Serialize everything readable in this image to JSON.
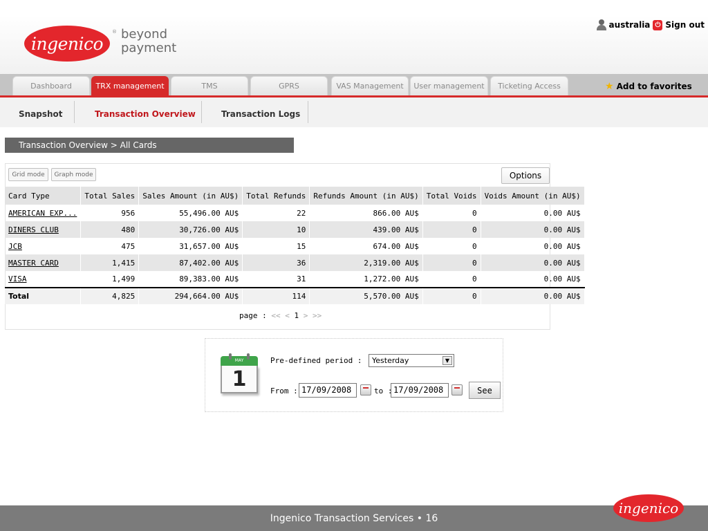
{
  "header": {
    "logo_text": "ingenico",
    "logo_mark": "®",
    "tagline_line1": "beyond",
    "tagline_line2": "payment",
    "user_name": "australia",
    "signout_label": "Sign out"
  },
  "menu": {
    "tabs": [
      {
        "label": "Dashboard"
      },
      {
        "label": "TRX management"
      },
      {
        "label": "TMS"
      },
      {
        "label": "GPRS"
      },
      {
        "label": "VAS Management"
      },
      {
        "label": "User management"
      },
      {
        "label": "Ticketing Access"
      }
    ],
    "active_tab": "TRX management",
    "favorites_label": "Add to favorites"
  },
  "subnav": {
    "items": [
      {
        "label": "Snapshot"
      },
      {
        "label": "Transaction Overview"
      },
      {
        "label": "Transaction Logs"
      }
    ],
    "active": "Transaction Overview"
  },
  "breadcrumb": "Transaction Overview > All Cards",
  "toolbar": {
    "grid_mode": "Grid mode",
    "graph_mode": "Graph mode",
    "options": "Options"
  },
  "table": {
    "columns": [
      "Card Type",
      "Total Sales",
      "Sales Amount (in AU$)",
      "Total Refunds",
      "Refunds Amount (in AU$)",
      "Total Voids",
      "Voids Amount (in AU$)"
    ],
    "rows": [
      [
        "AMERICAN EXP...",
        "956",
        "55,496.00 AU$",
        "22",
        "866.00 AU$",
        "0",
        "0.00 AU$"
      ],
      [
        "DINERS CLUB",
        "480",
        "30,726.00 AU$",
        "10",
        "439.00 AU$",
        "0",
        "0.00 AU$"
      ],
      [
        "JCB",
        "475",
        "31,657.00 AU$",
        "15",
        "674.00 AU$",
        "0",
        "0.00 AU$"
      ],
      [
        "MASTER CARD",
        "1,415",
        "87,402.00 AU$",
        "36",
        "2,319.00 AU$",
        "0",
        "0.00 AU$"
      ],
      [
        "VISA",
        "1,499",
        "89,383.00 AU$",
        "31",
        "1,272.00 AU$",
        "0",
        "0.00 AU$"
      ]
    ],
    "total": [
      "Total",
      "4,825",
      "294,664.00 AU$",
      "114",
      "5,570.00 AU$",
      "0",
      "0.00 AU$"
    ]
  },
  "pager": {
    "label": "page :",
    "first": "<<",
    "prev": "<",
    "current": "1",
    "next": ">",
    "last": ">>"
  },
  "period": {
    "calendar_month": "MAY",
    "calendar_day": "1",
    "predefined_label": "Pre-defined period :",
    "predefined_value": "Yesterday",
    "from_label": "From :",
    "from_value": "17/09/2008",
    "to_label": "to :",
    "to_value": "17/09/2008",
    "see_label": "See"
  },
  "footer": {
    "text": "Ingenico Transaction Services • 16",
    "logo_text": "ingenico"
  },
  "colors": {
    "brand_red": "#e3262c",
    "active_tab": "#d62a2a",
    "breadcrumb_bg": "#666666",
    "footer_bg": "#7b7b7b"
  },
  "icons": [
    "user-icon",
    "signout-icon",
    "star-icon",
    "calendar-icon",
    "dropdown-arrow-icon",
    "date-picker-icon"
  ]
}
